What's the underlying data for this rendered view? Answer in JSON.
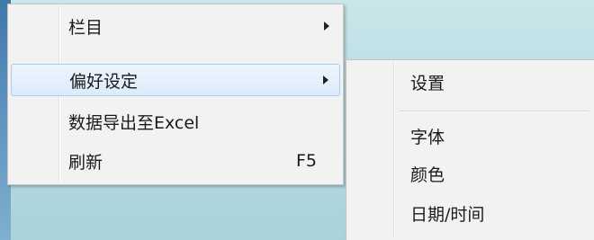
{
  "main_menu": {
    "items": [
      {
        "label": "栏目",
        "has_submenu": true
      },
      {
        "label": "偏好设定",
        "has_submenu": true
      },
      {
        "label": "数据导出至Excel"
      },
      {
        "label": "刷新",
        "shortcut": "F5"
      }
    ]
  },
  "sub_menu": {
    "items": [
      {
        "label": "设置"
      },
      {
        "label": "字体"
      },
      {
        "label": "颜色"
      },
      {
        "label": "日期/时间"
      }
    ]
  }
}
